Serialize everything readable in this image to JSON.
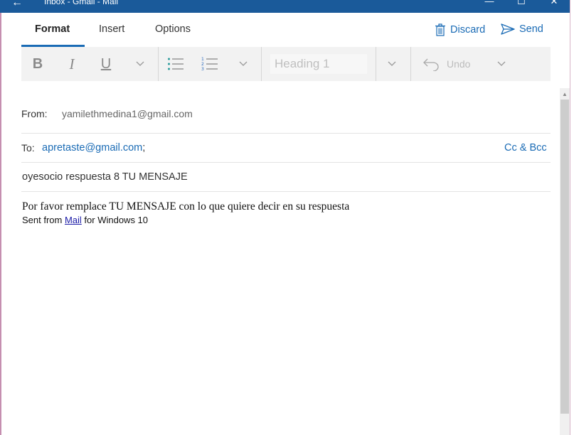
{
  "window": {
    "title": "Inbox - Gmail - Mail",
    "back_icon": "←",
    "minimize": "—",
    "maximize": "☐",
    "close": "✕"
  },
  "tabs": [
    "Format",
    "Insert",
    "Options"
  ],
  "active_tab": "Format",
  "actions": {
    "discard": "Discard",
    "send": "Send"
  },
  "toolbar": {
    "bold": "B",
    "italic": "I",
    "underline": "U",
    "style_value": "Heading 1",
    "undo": "Undo"
  },
  "message": {
    "from_label": "From:",
    "from": "yamilethmedina1@gmail.com",
    "to_label": "To:",
    "to": "apretaste@gmail.com",
    "to_separator": ";",
    "cc_bcc": "Cc & Bcc",
    "subject": "oyesocio respuesta 8 TU MENSAJE",
    "body_line1": "Por favor remplace TU MENSAJE con lo que quiere decir en su respuesta",
    "signature_prefix": "Sent from ",
    "signature_link": "Mail",
    "signature_suffix": " for Windows 10"
  },
  "colors": {
    "titlebar": "#1a5a9a",
    "accent": "#1a6bb5",
    "toolbar_bg": "#f2f2f2"
  }
}
